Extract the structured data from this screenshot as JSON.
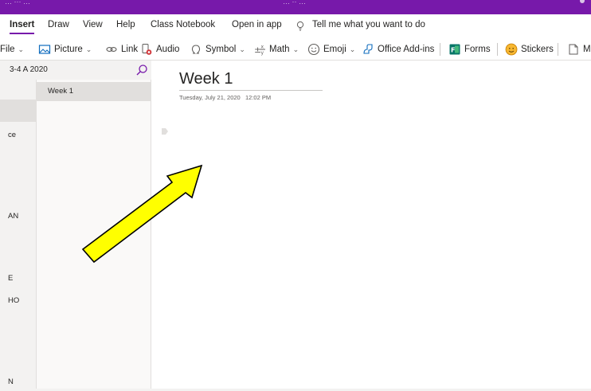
{
  "titlebar": {
    "left_text": "… ··· …",
    "center_text": "… ·· …"
  },
  "tabs": [
    {
      "label": "Insert",
      "active": true
    },
    {
      "label": "Draw"
    },
    {
      "label": "View"
    },
    {
      "label": "Help"
    },
    {
      "label": "Class Notebook"
    },
    {
      "label": "Open in app"
    },
    {
      "label": "Tell me what you want to do"
    }
  ],
  "ribbon": {
    "file": "File",
    "picture": "Picture",
    "link": "Link",
    "audio": "Audio",
    "symbol": "Symbol",
    "math": "Math",
    "emoji": "Emoji",
    "office_addins": "Office Add-ins",
    "forms": "Forms",
    "stickers": "Stickers",
    "more": "M"
  },
  "notebook": {
    "title": "3-4 A 2020",
    "sections": [
      "ce",
      "AN",
      "E",
      "HO",
      "N"
    ],
    "pages": [
      "Week 1"
    ]
  },
  "page": {
    "title": "Week 1",
    "date": "Tuesday, July 21, 2020",
    "time": "12:02 PM"
  },
  "colors": {
    "brand": "#7719aa",
    "arrow_fill": "#ffff00",
    "arrow_stroke": "#000000"
  }
}
